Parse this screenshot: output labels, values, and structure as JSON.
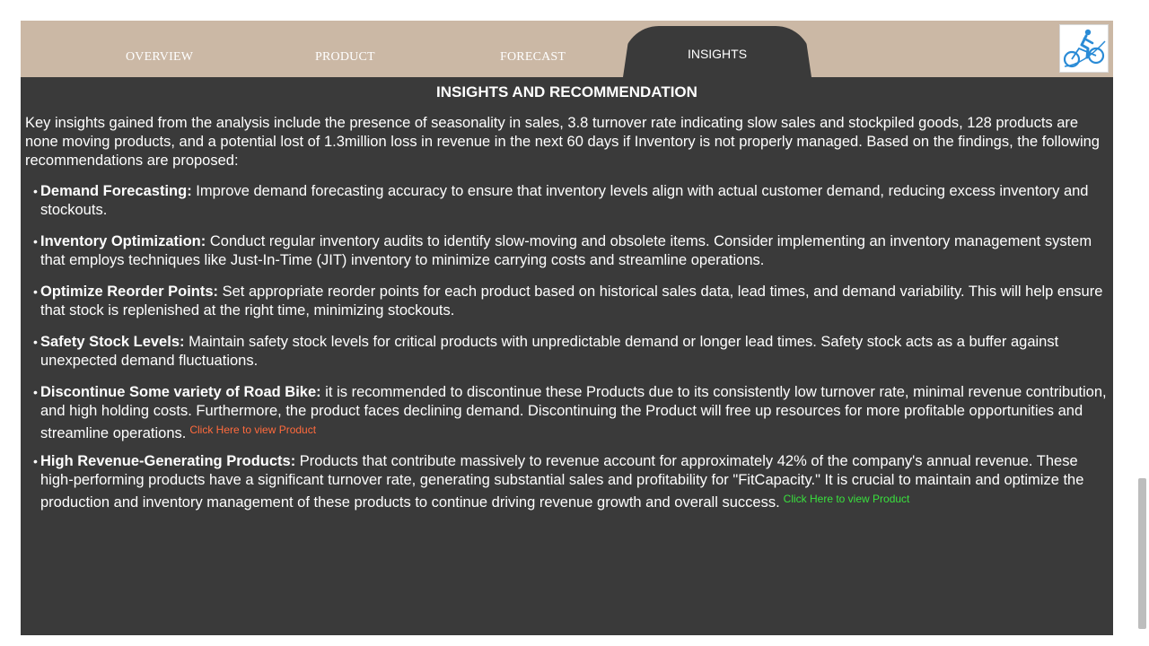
{
  "nav": {
    "tabs": [
      {
        "label": "OVERVIEW"
      },
      {
        "label": "PRODUCT"
      },
      {
        "label": "FORECAST"
      },
      {
        "label": "INSIGHTS"
      }
    ],
    "active_tab": "INSIGHTS",
    "logo_icon": "cyclist-icon"
  },
  "colors": {
    "topbar": "#cbb8a5",
    "canvas": "#3a3a3a",
    "link_orange": "#ff6a3d",
    "link_green": "#39e03d",
    "logo_blue": "#2a8bd6"
  },
  "main": {
    "title": "INSIGHTS AND RECOMMENDATION",
    "intro": "Key insights gained from the analysis include the presence of seasonality in sales, 3.8 turnover rate indicating slow sales and stockpiled goods,  128 products are none moving products, and a potential lost of 1.3million loss in revenue in the next 60 days if Inventory is not properly managed. Based on the findings, the following recommendations are proposed:",
    "recommendations": [
      {
        "title": "Demand Forecasting:",
        "text": " Improve demand forecasting accuracy to ensure that inventory levels align with actual customer demand, reducing excess inventory and stockouts."
      },
      {
        "title": "Inventory Optimization:",
        "text": " Conduct regular inventory audits to identify slow-moving and obsolete items. Consider implementing an inventory management system that employs techniques like Just-In-Time (JIT) inventory to minimize carrying costs and streamline operations."
      },
      {
        "title": "Optimize Reorder Points:",
        "text": " Set appropriate reorder points for each product based on historical sales data, lead times, and demand variability. This will help ensure that stock is replenished at the right time, minimizing stockouts."
      },
      {
        "title": "Safety Stock Levels:",
        "text": " Maintain safety stock levels for critical products with unpredictable demand or longer lead times. Safety stock acts as a buffer against unexpected demand fluctuations."
      },
      {
        "title": "Discontinue Some variety of Road Bike:",
        "text": " it is recommended to discontinue these Products due to its consistently low turnover rate, minimal revenue contribution, and high holding costs. Furthermore, the product faces declining demand. Discontinuing the Product will free up resources for more profitable opportunities and streamline operations.",
        "link": "Click Here to view Product"
      },
      {
        "title": "High Revenue-Generating Products:",
        "text": " Products that contribute massively to revenue account for approximately 42% of the company's annual revenue. These high-performing products have a significant turnover rate, generating substantial sales and profitability for \"FitCapacity.\" It is crucial to maintain and optimize the production and inventory management of these products to continue driving revenue growth and overall success.",
        "link": "Click Here to view Product"
      }
    ]
  }
}
